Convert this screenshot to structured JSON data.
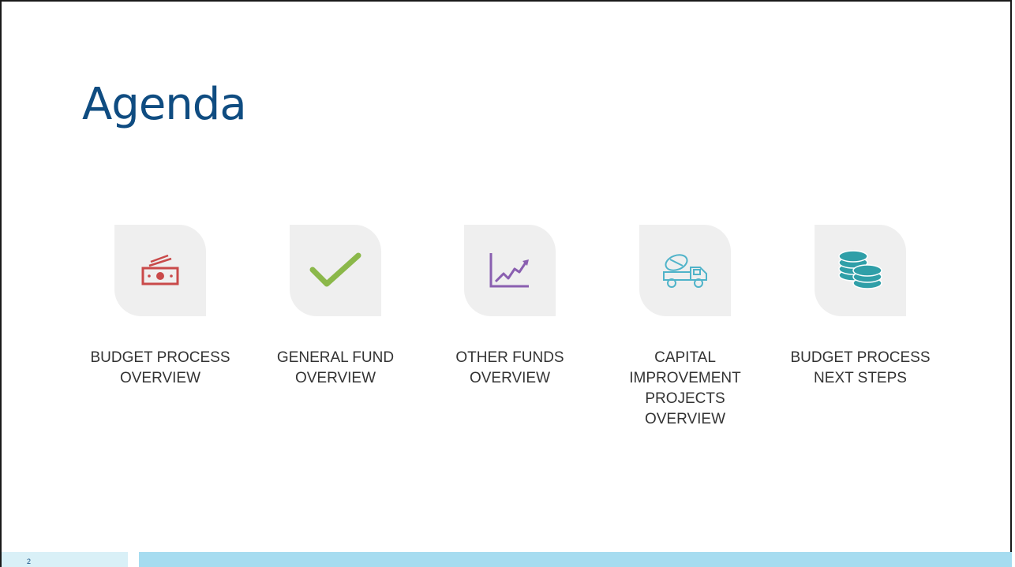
{
  "slide": {
    "title": "Agenda",
    "page_number": "2"
  },
  "items": [
    {
      "label": "BUDGET PROCESS OVERVIEW",
      "icon": "money-bills-icon",
      "color": "#c94a4a"
    },
    {
      "label": "GENERAL FUND OVERVIEW",
      "icon": "checkmark-icon",
      "color": "#8bb84a"
    },
    {
      "label": "OTHER FUNDS OVERVIEW",
      "icon": "line-chart-icon",
      "color": "#8a5fb0"
    },
    {
      "label": "CAPITAL IMPROVEMENT PROJECTS OVERVIEW",
      "icon": "cement-truck-icon",
      "color": "#4fb3c9"
    },
    {
      "label": "BUDGET PROCESS NEXT STEPS",
      "icon": "coin-stacks-icon",
      "color": "#2f9fa8"
    }
  ],
  "colors": {
    "title": "#0f4c81",
    "footer_light": "#d9f0f7",
    "footer_dark": "#a6dcf0"
  }
}
